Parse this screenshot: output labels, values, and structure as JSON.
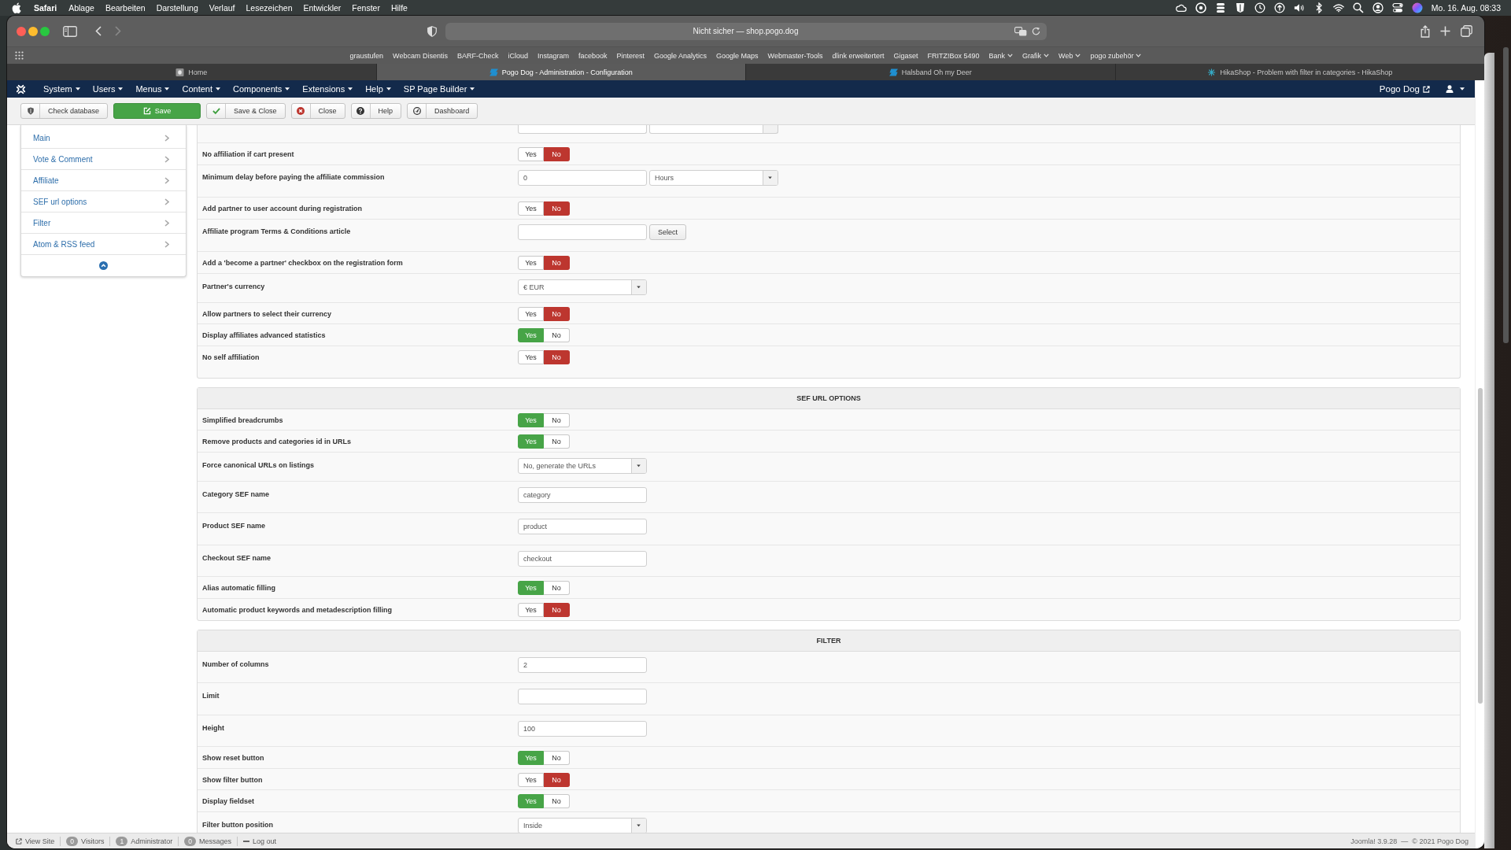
{
  "menu_bar": {
    "app": "Safari",
    "menus": [
      "Ablage",
      "Bearbeiten",
      "Darstellung",
      "Verlauf",
      "Lesezeichen",
      "Entwickler",
      "Fenster",
      "Hilfe"
    ],
    "clock": "Mo. 16. Aug. 08:33"
  },
  "browser": {
    "address": "Nicht sicher — shop.pogo.dog",
    "bookmarks": [
      {
        "label": "graustufen",
        "folder": false
      },
      {
        "label": "Webcam Disentis",
        "folder": false
      },
      {
        "label": "BARF-Check",
        "folder": false
      },
      {
        "label": "iCloud",
        "folder": false
      },
      {
        "label": "Instagram",
        "folder": false
      },
      {
        "label": "facebook",
        "folder": false
      },
      {
        "label": "Pinterest",
        "folder": false
      },
      {
        "label": "Google Analytics",
        "folder": false
      },
      {
        "label": "Google Maps",
        "folder": false
      },
      {
        "label": "Webmaster-Tools",
        "folder": false
      },
      {
        "label": "dlink erweitertert",
        "folder": false
      },
      {
        "label": "Gigaset",
        "folder": false
      },
      {
        "label": "FRITZ!Box 5490",
        "folder": false
      },
      {
        "label": "Bank",
        "folder": true
      },
      {
        "label": "Grafik",
        "folder": true
      },
      {
        "label": "Web",
        "folder": true
      },
      {
        "label": "pogo zubehör",
        "folder": true
      }
    ],
    "tabs": [
      {
        "title": "Home",
        "kind": "tile",
        "selected": false
      },
      {
        "title": "Pogo Dog - Administration - Configuration",
        "kind": "ribbon",
        "selected": true
      },
      {
        "title": "Halsband Oh my Deer",
        "kind": "ribbon",
        "selected": false
      },
      {
        "title": "HikaShop - Problem with filter in categories - HikaShop",
        "kind": "asterisk",
        "selected": false
      }
    ]
  },
  "admin": {
    "menus": [
      "System",
      "Users",
      "Menus",
      "Content",
      "Components",
      "Extensions",
      "Help",
      "SP Page Builder"
    ],
    "site_link": "Pogo Dog",
    "toolbar": [
      {
        "label": "Check database",
        "kind": "check"
      },
      {
        "label": "Save",
        "kind": "save"
      },
      {
        "label": "Save & Close",
        "kind": "save_close"
      },
      {
        "label": "Close",
        "kind": "close"
      },
      {
        "label": "Help",
        "kind": "help"
      },
      {
        "label": "Dashboard",
        "kind": "dashboard"
      }
    ],
    "sidebar": [
      "Main",
      "Vote & Comment",
      "Affiliate",
      "SEF url options",
      "Filter",
      "Atom & RSS feed"
    ],
    "sections": [
      {
        "rows": [
          {
            "kind": "clipped"
          },
          {
            "kind": "toggle",
            "label": "No affiliation if cart present",
            "options": [
              {
                "label": "Yes",
                "selected": false
              },
              {
                "label": "No",
                "selected": true
              }
            ]
          },
          {
            "kind": "input_select",
            "label": "Minimum delay before paying the affiliate commission",
            "value": "0",
            "select": "Hours"
          },
          {
            "kind": "toggle",
            "label": "Add partner to user account during registration",
            "options": [
              {
                "label": "Yes",
                "selected": false
              },
              {
                "label": "No",
                "selected": true
              }
            ]
          },
          {
            "kind": "input_button",
            "label": "Affiliate program Terms & Conditions article",
            "button": "Select"
          },
          {
            "kind": "toggle",
            "label": "Add a 'become a partner' checkbox on the registration form",
            "options": [
              {
                "label": "Yes",
                "selected": false
              },
              {
                "label": "No",
                "selected": true
              }
            ]
          },
          {
            "kind": "select",
            "label": "Partner's currency",
            "value": "€ EUR"
          },
          {
            "kind": "toggle",
            "label": "Allow partners to select their currency",
            "options": [
              {
                "label": "Yes",
                "selected": false
              },
              {
                "label": "No",
                "selected": true
              }
            ]
          },
          {
            "kind": "toggle",
            "label": "Display affiliates advanced statistics",
            "options": [
              {
                "label": "Yes",
                "selected": true
              },
              {
                "label": "No",
                "selected": false
              }
            ]
          },
          {
            "kind": "toggle",
            "label": "No self affiliation",
            "options": [
              {
                "label": "Yes",
                "selected": false
              },
              {
                "label": "No",
                "selected": true
              }
            ]
          }
        ]
      },
      {
        "title": "SEF URL OPTIONS",
        "rows": [
          {
            "kind": "toggle",
            "label": "Simplified breadcrumbs",
            "options": [
              {
                "label": "Yes",
                "selected": true
              },
              {
                "label": "No",
                "selected": false
              }
            ]
          },
          {
            "kind": "toggle",
            "label": "Remove products and categories id in URLs",
            "options": [
              {
                "label": "Yes",
                "selected": true
              },
              {
                "label": "No",
                "selected": false
              }
            ]
          },
          {
            "kind": "select",
            "label": "Force canonical URLs on listings",
            "value": "No, generate the URLs"
          },
          {
            "kind": "input",
            "label": "Category SEF name",
            "value": "category"
          },
          {
            "kind": "input",
            "label": "Product SEF name",
            "value": "product"
          },
          {
            "kind": "input",
            "label": "Checkout SEF name",
            "value": "checkout"
          },
          {
            "kind": "toggle",
            "label": "Alias automatic filling",
            "options": [
              {
                "label": "Yes",
                "selected": true
              },
              {
                "label": "No",
                "selected": false
              }
            ]
          },
          {
            "kind": "toggle",
            "label": "Automatic product keywords and metadescription filling",
            "options": [
              {
                "label": "Yes",
                "selected": false
              },
              {
                "label": "No",
                "selected": true
              }
            ]
          }
        ]
      },
      {
        "title": "FILTER",
        "rows": [
          {
            "kind": "input",
            "label": "Number of columns",
            "value": "2"
          },
          {
            "kind": "input",
            "label": "Limit"
          },
          {
            "kind": "input",
            "label": "Height",
            "value": "100"
          },
          {
            "kind": "toggle",
            "label": "Show reset button",
            "options": [
              {
                "label": "Yes",
                "selected": true
              },
              {
                "label": "No",
                "selected": false
              }
            ]
          },
          {
            "kind": "toggle",
            "label": "Show filter button",
            "options": [
              {
                "label": "Yes",
                "selected": false
              },
              {
                "label": "No",
                "selected": true
              }
            ]
          },
          {
            "kind": "toggle",
            "label": "Display fieldset",
            "options": [
              {
                "label": "Yes",
                "selected": true
              },
              {
                "label": "No",
                "selected": false
              }
            ]
          },
          {
            "kind": "select",
            "label": "Filter button position",
            "value": "Inside"
          }
        ]
      }
    ]
  },
  "status_bar": {
    "links": [
      {
        "kind": "view_site",
        "label": "View Site"
      },
      {
        "kind": "count",
        "count": "0",
        "label": "Visitors"
      },
      {
        "kind": "count",
        "count": "1",
        "label": "Administrator"
      },
      {
        "kind": "count",
        "count": "0",
        "label": "Messages"
      },
      {
        "kind": "logout",
        "label": "Log out"
      }
    ],
    "footer": "Joomla! 3.9.28  —  © 2021 Pogo Dog"
  }
}
